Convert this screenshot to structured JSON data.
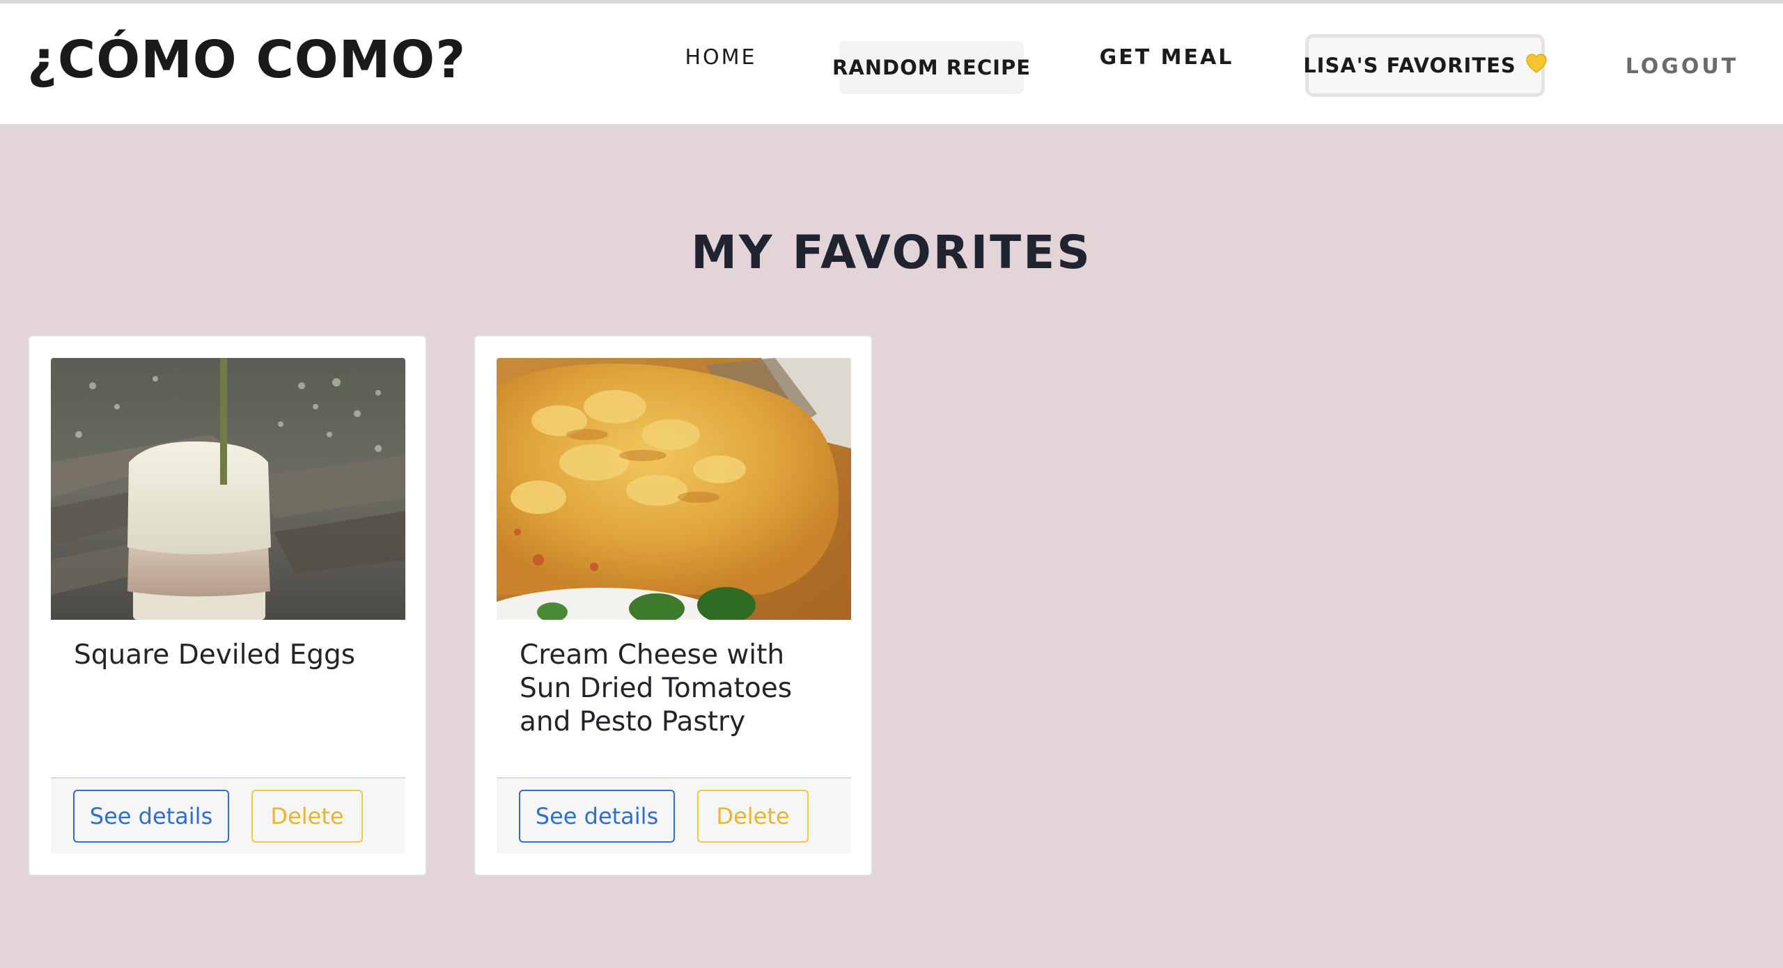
{
  "header": {
    "brand": "¿CÓMO COMO?",
    "nav": {
      "home": "HOME",
      "random_recipe": "RANDOM RECIPE",
      "get_meal": "GET MEAL",
      "favorites": "LISA'S FAVORITES",
      "favorites_icon": "yellow-heart-icon",
      "logout": "LOGOUT"
    }
  },
  "page": {
    "title": "MY FAVORITES"
  },
  "favorites": [
    {
      "title": "Square Deviled Eggs",
      "image_icon": "deviled-eggs-photo",
      "details_label": "See details",
      "delete_label": "Delete"
    },
    {
      "title": "Cream Cheese with Sun Dried Tomatoes and Pesto Pastry",
      "image_icon": "pesto-pastry-photo",
      "details_label": "See details",
      "delete_label": "Delete"
    }
  ],
  "colors": {
    "page_background": "#e3d4d8",
    "details_button": "#2c6fd1",
    "delete_button": "#e5b533",
    "heart": "#f5c531"
  }
}
